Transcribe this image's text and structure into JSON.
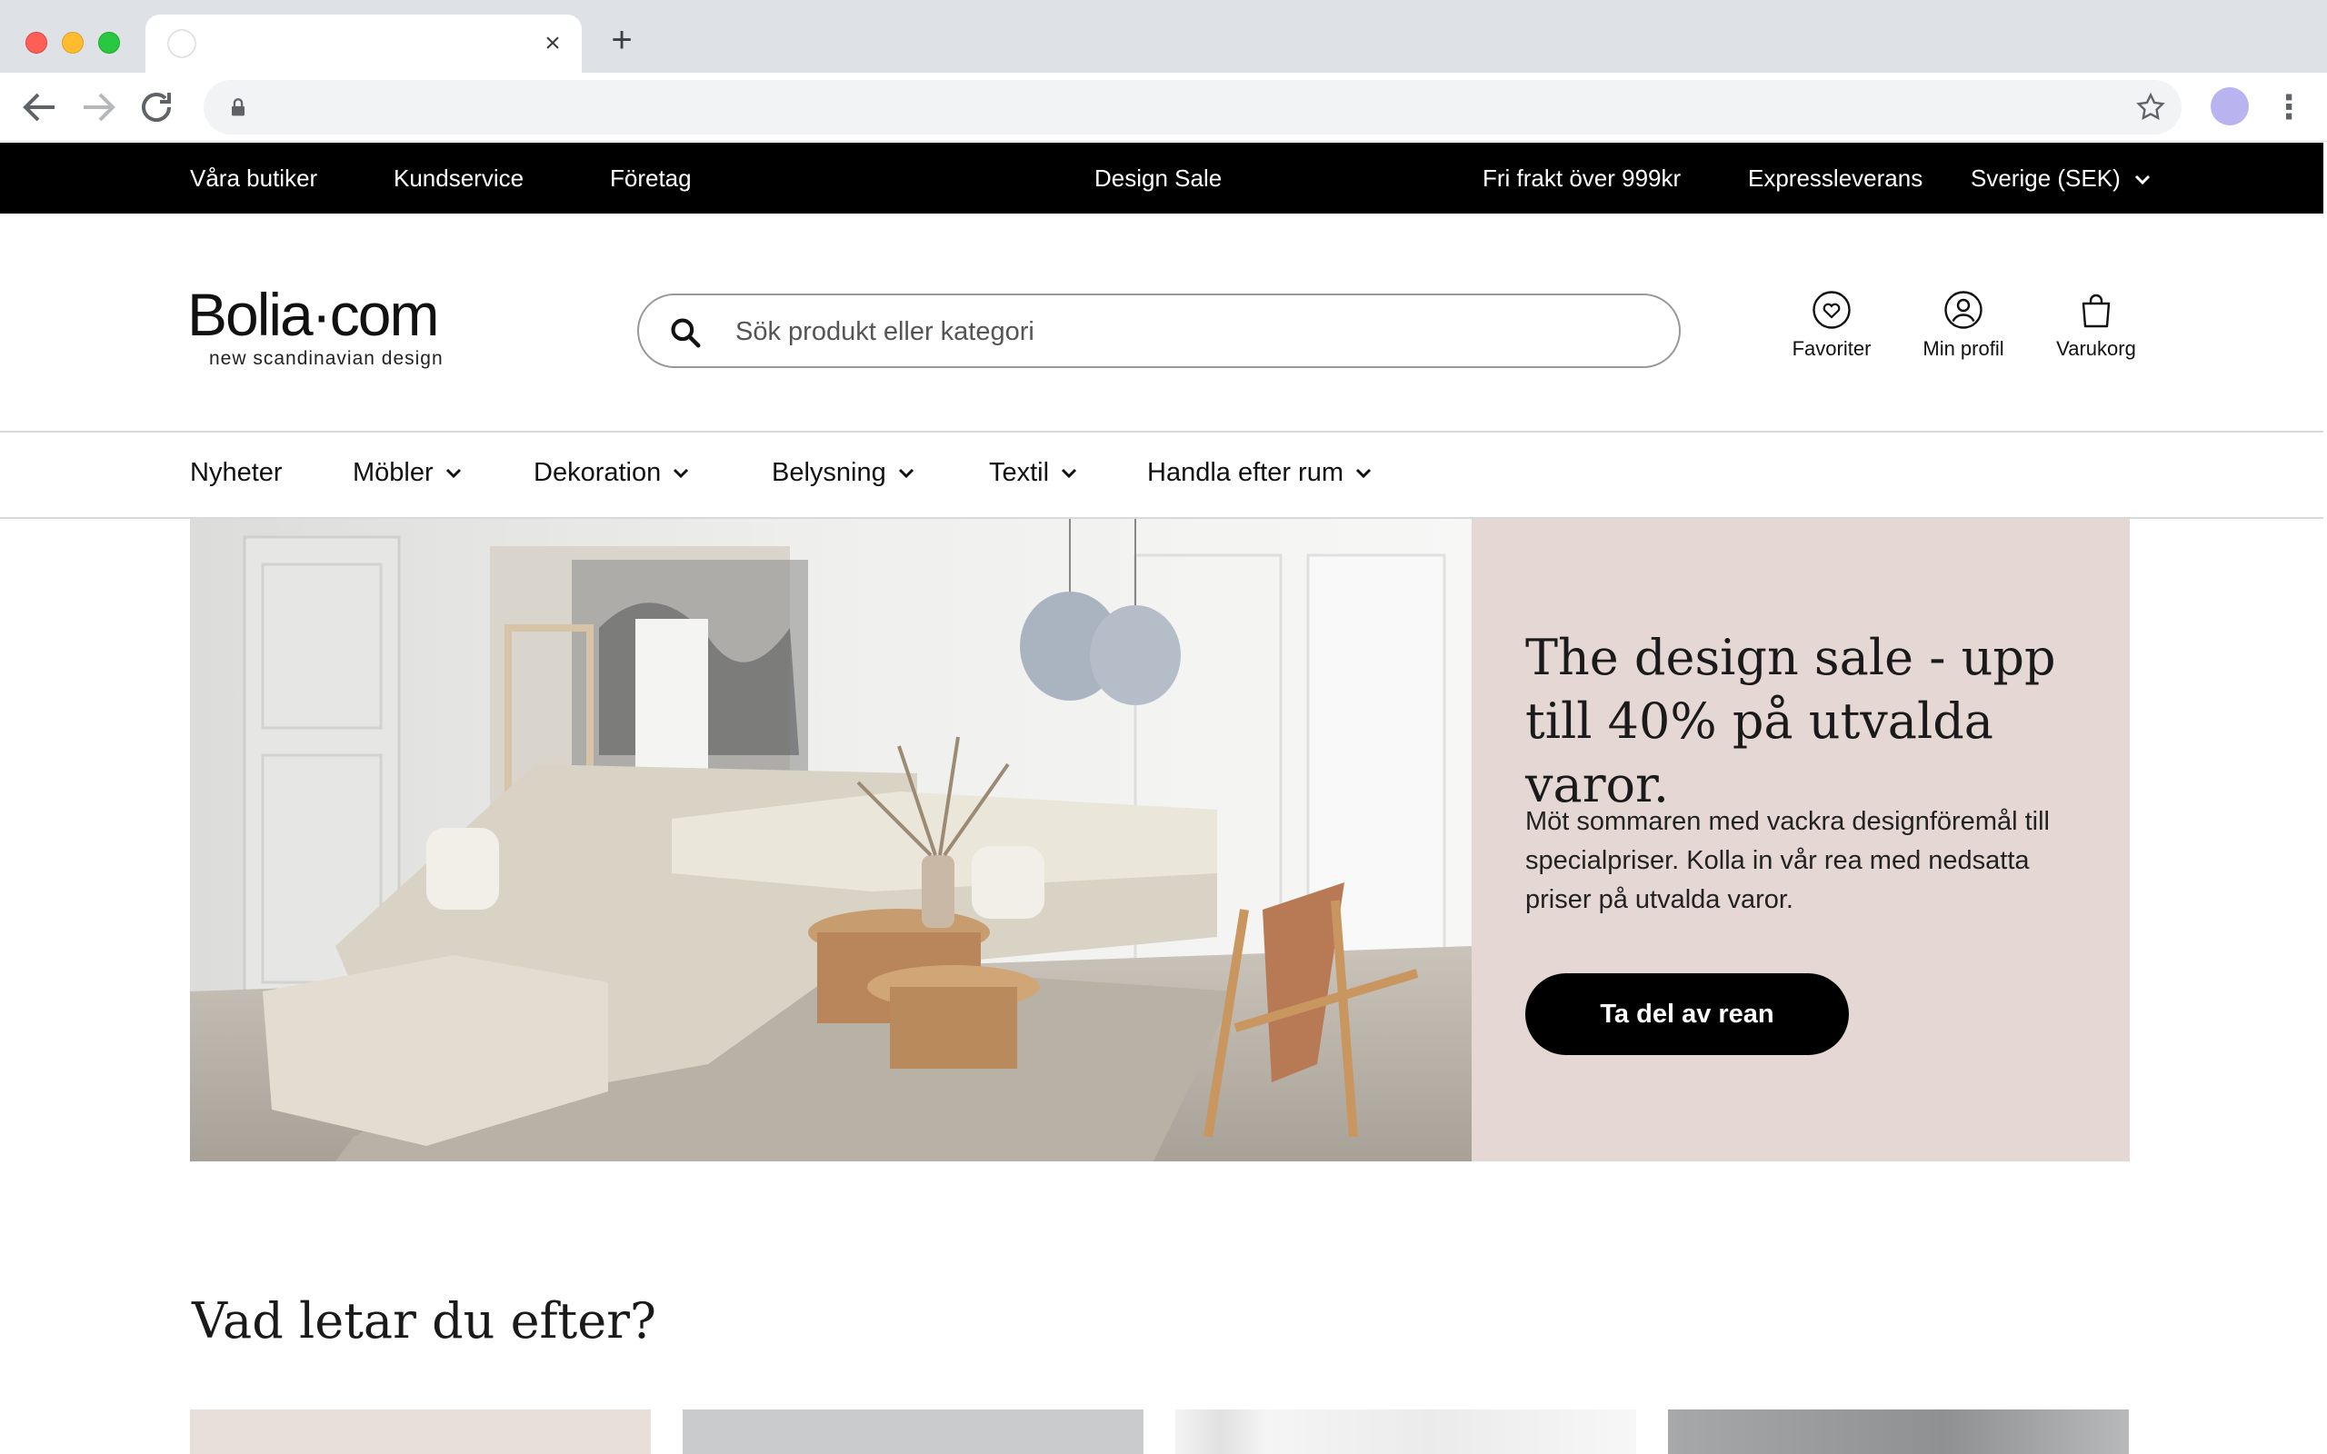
{
  "browser": {
    "tab_title": "",
    "close_glyph": "×",
    "new_tab_glyph": "+",
    "url": ""
  },
  "topbar": {
    "links": [
      "Våra butiker",
      "Kundservice",
      "Företag"
    ],
    "promo": "Design Sale",
    "shipping": "Fri frakt över 999kr",
    "express": "Expressleverans",
    "region": "Sverige (SEK)"
  },
  "header": {
    "logo_main": "Bolia·com",
    "logo_tagline": "new scandinavian design",
    "search_placeholder": "Sök produkt eller kategori",
    "actions": {
      "favorites": "Favoriter",
      "profile": "Min profil",
      "cart": "Varukorg"
    }
  },
  "nav": {
    "items": [
      "Nyheter",
      "Möbler",
      "Dekoration",
      "Belysning",
      "Textil",
      "Handla efter rum"
    ]
  },
  "hero": {
    "title": "The design sale - upp till 40% på utvalda varor.",
    "text": "Möt sommaren med vackra designföremål till specialpriser. Kolla in vår rea med nedsatta priser på utvalda varor.",
    "cta": "Ta del av rean"
  },
  "section": {
    "title": "Vad letar du efter?"
  },
  "colors": {
    "topbar_bg": "#000000",
    "hero_panel_bg": "#e5d7d3",
    "cta_bg": "#000000",
    "profile_avatar": "#b9b3ef"
  },
  "icons": [
    "lock-icon",
    "star-icon",
    "search-icon",
    "heart-icon",
    "user-icon",
    "bag-icon",
    "chevron-down-icon"
  ]
}
